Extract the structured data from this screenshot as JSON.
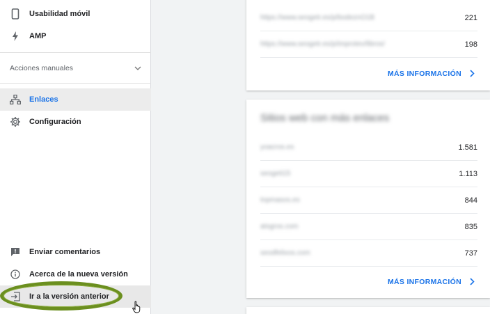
{
  "sidebar": {
    "items_top": [
      {
        "label": "Usabilidad móvil",
        "icon": "phone-icon"
      },
      {
        "label": "AMP",
        "icon": "bolt-icon"
      }
    ],
    "manual_actions": "Acciones manuales",
    "items_mid": [
      {
        "label": "Enlaces",
        "icon": "links-icon",
        "active": true
      },
      {
        "label": "Configuración",
        "icon": "gear-icon"
      }
    ],
    "items_bottom": [
      {
        "label": "Enviar comentarios",
        "icon": "feedback-icon"
      },
      {
        "label": "Acerca de la nueva versión",
        "icon": "info-icon"
      },
      {
        "label": "Ir a la versión anterior",
        "icon": "exit-icon"
      }
    ]
  },
  "cards": [
    {
      "rows": [
        {
          "site": "https://www.seogetr.es/p/bodeznO1B",
          "count": "221"
        },
        {
          "site": "https://www.seogetr.es/p/improtev/libros/",
          "count": "198"
        }
      ],
      "more": "MÁS INFORMACIÓN"
    },
    {
      "title": "Sitios web con más enlaces",
      "rows": [
        {
          "site": "yoacros.es",
          "count": "1.581"
        },
        {
          "site": "seogeti15",
          "count": "1.113"
        },
        {
          "site": "tnpmasos.es",
          "count": "844"
        },
        {
          "site": "atsgros.com",
          "count": "835"
        },
        {
          "site": "seodfelixos.com",
          "count": "737"
        }
      ],
      "more": "MÁS INFORMACIÓN"
    }
  ],
  "colors": {
    "accent": "#1a73e8",
    "highlight_ring": "#6b8f1f"
  }
}
